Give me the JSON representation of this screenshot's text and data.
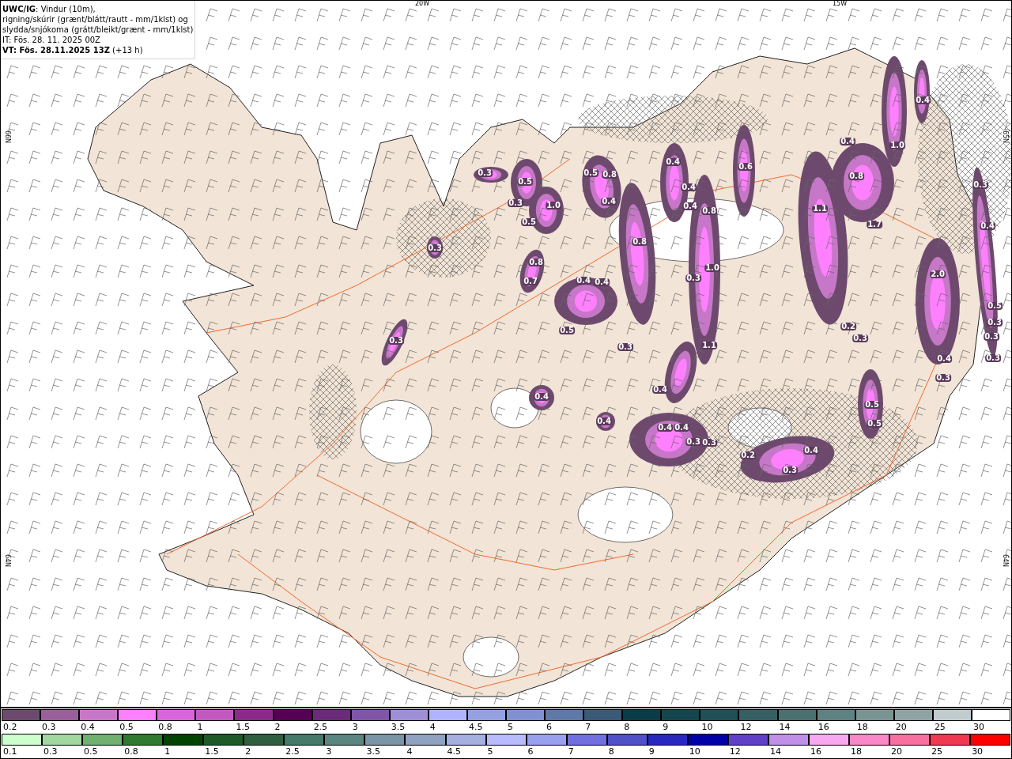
{
  "title_lines": [
    "**UWC/IG**: Vindur (10m),",
    "rigning/skúrir (grænt/blátt/rautt - mm/1klst) og",
    "slydda/snjókoma (grátt/bleikt/grænt - mm/1klst)",
    "IT: Fös. 28. 11. 2025 00Z",
    "**VT: Fös. 28.11.2025 13Z** (+13 h)"
  ],
  "lon_labels": [
    "20W",
    "15W"
  ],
  "lat_labels_left": [
    "66N",
    "64N"
  ],
  "lat_labels_right": [
    "65N",
    "64N"
  ],
  "precip_labels": [
    "0.3",
    "0.3",
    "0.3",
    "0.5",
    "0.3",
    "0.5",
    "1.0",
    "0.8",
    "0.7",
    "0.5",
    "0.8",
    "0.4",
    "0.8",
    "0.4",
    "0.4",
    "0.4",
    "0.8",
    "1.0",
    "0.4",
    "0.4",
    "0.3",
    "0.5",
    "0.3",
    "1.1",
    "0.4",
    "0.4",
    "0.4",
    "0.4",
    "0.4",
    "0.3",
    "0.3",
    "0.6",
    "1.1",
    "0.8",
    "1.7",
    "1.0",
    "0.4",
    "0.4",
    "0.3",
    "0.4",
    "2.0",
    "0.2",
    "0.3",
    "0.4",
    "0.3",
    "0.5",
    "0.3",
    "0.3",
    "0.3",
    "0.5",
    "0.5",
    "0.2",
    "0.4",
    "0.3"
  ],
  "legend_snow": [
    {
      "label": "0.2",
      "color": "#6d4a6d"
    },
    {
      "label": "0.3",
      "color": "#9a5f9a"
    },
    {
      "label": "0.4",
      "color": "#c777c7"
    },
    {
      "label": "0.5",
      "color": "#ff80ff"
    },
    {
      "label": "0.8",
      "color": "#d966d9"
    },
    {
      "label": "1",
      "color": "#c05ac0"
    },
    {
      "label": "1.5",
      "color": "#8b2a8b"
    },
    {
      "label": "2",
      "color": "#550055"
    },
    {
      "label": "2.5",
      "color": "#6b2a7a"
    },
    {
      "label": "3",
      "color": "#8055a8"
    },
    {
      "label": "3.5",
      "color": "#9e8fd6"
    },
    {
      "label": "4",
      "color": "#b0b4ff"
    },
    {
      "label": "4.5",
      "color": "#94a0e0"
    },
    {
      "label": "5",
      "color": "#8090d0"
    },
    {
      "label": "6",
      "color": "#5f78a8"
    },
    {
      "label": "7",
      "color": "#3a5a78"
    },
    {
      "label": "8",
      "color": "#0a3c48"
    },
    {
      "label": "9",
      "color": "#15464f"
    },
    {
      "label": "10",
      "color": "#1f5058"
    },
    {
      "label": "12",
      "color": "#355f62"
    },
    {
      "label": "14",
      "color": "#4a7070"
    },
    {
      "label": "16",
      "color": "#5e8282"
    },
    {
      "label": "18",
      "color": "#7a9494"
    },
    {
      "label": "20",
      "color": "#8fa3a5"
    },
    {
      "label": "25",
      "color": "#c0cccd"
    },
    {
      "label": "30",
      "color": "#ffffff"
    }
  ],
  "legend_rain": [
    {
      "label": "0.1",
      "color": "#ccffcc"
    },
    {
      "label": "0.3",
      "color": "#a0d8a0"
    },
    {
      "label": "0.5",
      "color": "#70b070"
    },
    {
      "label": "0.8",
      "color": "#307a30"
    },
    {
      "label": "1",
      "color": "#004400"
    },
    {
      "label": "1.5",
      "color": "#1e5a28"
    },
    {
      "label": "2",
      "color": "#2e6040"
    },
    {
      "label": "2.5",
      "color": "#457a6a"
    },
    {
      "label": "3",
      "color": "#5b8580"
    },
    {
      "label": "3.5",
      "color": "#7a95a5"
    },
    {
      "label": "4",
      "color": "#8fa3c0"
    },
    {
      "label": "4.5",
      "color": "#a5b0e0"
    },
    {
      "label": "5",
      "color": "#b8bcff"
    },
    {
      "label": "6",
      "color": "#9aa0f0"
    },
    {
      "label": "7",
      "color": "#7070e0"
    },
    {
      "label": "8",
      "color": "#5050c8"
    },
    {
      "label": "9",
      "color": "#2828c0"
    },
    {
      "label": "10",
      "color": "#0000a8"
    },
    {
      "label": "12",
      "color": "#6040c8"
    },
    {
      "label": "14",
      "color": "#c090e8"
    },
    {
      "label": "16",
      "color": "#f8a8f0"
    },
    {
      "label": "18",
      "color": "#f888c8"
    },
    {
      "label": "20",
      "color": "#f870a0"
    },
    {
      "label": "25",
      "color": "#f03850"
    },
    {
      "label": "30",
      "color": "#ff0000"
    }
  ]
}
